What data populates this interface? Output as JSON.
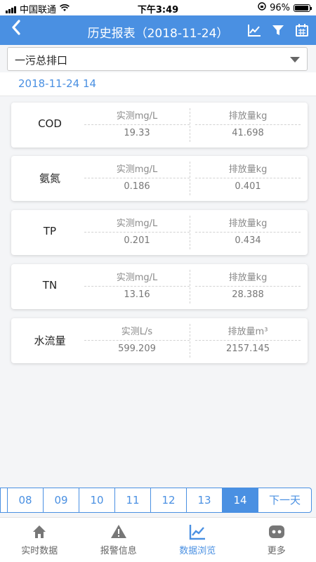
{
  "status_bar": {
    "carrier": "中国联通",
    "time": "下午3:49",
    "battery": "96%",
    "battery_level": 0.96
  },
  "nav": {
    "title": "历史报表（2018-11-24）"
  },
  "filter": {
    "selected": "一污总排口"
  },
  "date_label": "2018-11-24  14",
  "cards": [
    {
      "name": "COD",
      "measured_label": "实测mg/L",
      "measured_value": "19.33",
      "emission_label": "排放量kg",
      "emission_value": "41.698"
    },
    {
      "name": "氨氮",
      "measured_label": "实测mg/L",
      "measured_value": "0.186",
      "emission_label": "排放量kg",
      "emission_value": "0.401"
    },
    {
      "name": "TP",
      "measured_label": "实测mg/L",
      "measured_value": "0.201",
      "emission_label": "排放量kg",
      "emission_value": "0.434"
    },
    {
      "name": "TN",
      "measured_label": "实测mg/L",
      "measured_value": "13.16",
      "emission_label": "排放量kg",
      "emission_value": "28.388"
    },
    {
      "name": "水流量",
      "measured_label": "实测L/s",
      "measured_value": "599.209",
      "emission_label": "排放量m³",
      "emission_value": "2157.145"
    }
  ],
  "pager": {
    "hours": [
      "08",
      "09",
      "10",
      "11",
      "12",
      "13",
      "14"
    ],
    "active": "14",
    "next_label": "下一天"
  },
  "tabs": [
    {
      "label": "实时数据",
      "icon": "home-icon"
    },
    {
      "label": "报警信息",
      "icon": "warning-icon"
    },
    {
      "label": "数据浏览",
      "icon": "chart-icon"
    },
    {
      "label": "更多",
      "icon": "more-icon"
    }
  ],
  "colors": {
    "accent": "#4a90e2"
  }
}
